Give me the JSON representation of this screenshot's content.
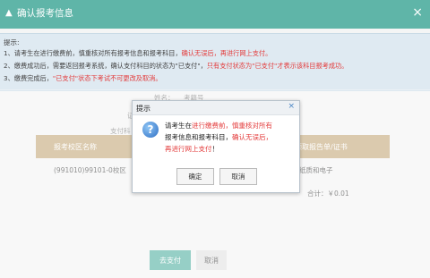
{
  "window": {
    "title": "确认报考信息",
    "close_icon": "×"
  },
  "notice": {
    "heading": "提示:",
    "line1": {
      "a": "1、请考生在进行缴费前，慎重核对所有报考信息和报考科目，",
      "b": "确认无误后，再进行网上支付。"
    },
    "line2": {
      "a": "2、缴费成功后，需要返回报考系统，确认支付科目的状态为\"已支付\"，",
      "b": "只有支付状态为\"已支付\"才表示该科目报考成功。"
    },
    "line3": {
      "a": "3、缴费完成后，",
      "b": "\"已支付\"状态下考试不可更改及取消。"
    }
  },
  "background": {
    "partial1": "姓名：",
    "partial2": "考籍号",
    "partial3": "支付科",
    "partial4": "证"
  },
  "table": {
    "col1": "报考校区名称",
    "col2": "领取报告单/证书",
    "row1": {
      "campus": "(991010)99101-0校区",
      "cert": "纸质和电子"
    }
  },
  "total": "合计：￥0.01",
  "buttons": {
    "pay": "去支付",
    "cancel": "取消"
  },
  "dialog": {
    "title": "提示",
    "close_icon": "×",
    "line1": {
      "a": "请考生在",
      "b": "进行缴费前，慎重核对所有"
    },
    "line2": {
      "a": "报考信息和报考科目，",
      "b": "确认无误后，"
    },
    "line3": {
      "a": "再进行网上支付",
      "b": "！"
    },
    "ok": "确定",
    "cancel": "取消"
  }
}
